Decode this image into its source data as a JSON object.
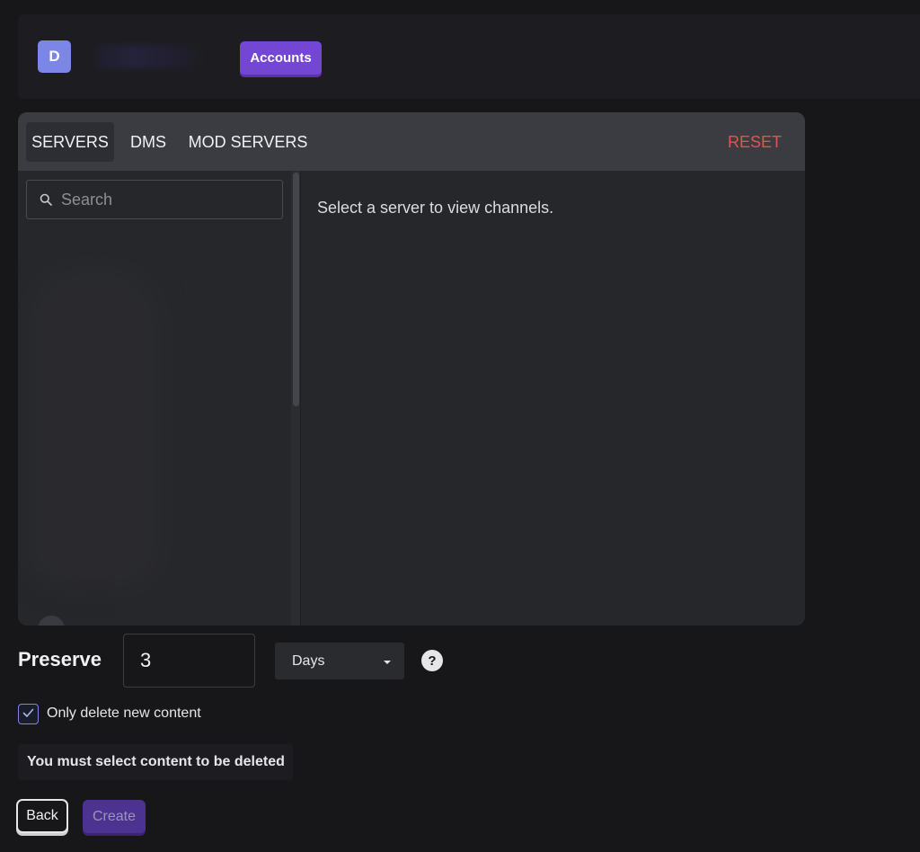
{
  "header": {
    "avatar_letter": "D",
    "accounts_button": "Accounts"
  },
  "tabs": {
    "servers": "SERVERS",
    "dms": "DMS",
    "mod_servers": "MOD SERVERS",
    "reset": "RESET"
  },
  "sidebar": {
    "search_placeholder": "Search"
  },
  "content": {
    "message": "Select a server to view channels."
  },
  "preserve": {
    "label": "Preserve",
    "value": "3",
    "unit": "Days",
    "help": "?"
  },
  "options": {
    "only_new_label": "Only delete new content",
    "only_new_checked": true
  },
  "warning": "You must select content to be deleted",
  "buttons": {
    "back": "Back",
    "create": "Create"
  },
  "colors": {
    "accent": "#7347d4",
    "reset": "#e05353",
    "avatar": "#7b86e6"
  }
}
